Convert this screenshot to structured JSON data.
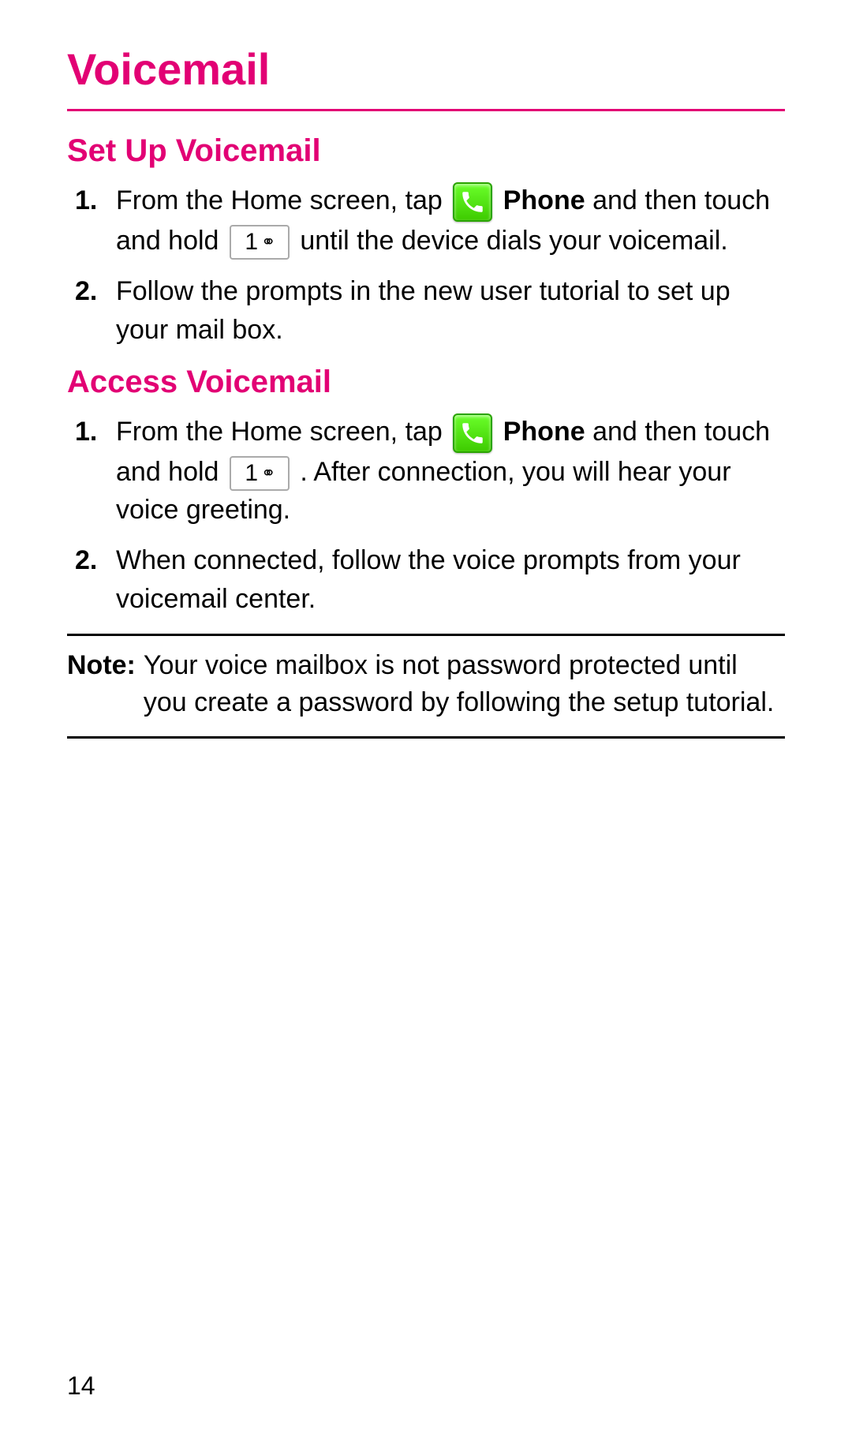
{
  "title": "Voicemail",
  "colors": {
    "accent": "#e20074",
    "phone_icon_bg": "#3ecb00"
  },
  "icons": {
    "phone": "phone-icon",
    "key1vm_digit": "1",
    "key1vm_glyph": "⚭"
  },
  "sections": {
    "setup": {
      "heading": "Set Up Voicemail",
      "steps": [
        {
          "pre": "From the Home screen, tap ",
          "bold1": "Phone",
          "mid1": " and then touch and hold ",
          "post": " until the device dials your voicemail."
        },
        {
          "text": "Follow the prompts in the new user tutorial to set up your mail box."
        }
      ]
    },
    "access": {
      "heading": "Access Voicemail",
      "steps": [
        {
          "pre": "From the Home screen, tap ",
          "bold1": "Phone",
          "mid1": " and then touch and hold ",
          "post": ". After connection, you will hear your voice greeting."
        },
        {
          "text": "When connected, follow the voice prompts from your voicemail center."
        }
      ]
    }
  },
  "note": {
    "label": "Note:",
    "text": "Your voice mailbox is not password protected until you create a password by following the setup tutorial."
  },
  "page_number": "14"
}
